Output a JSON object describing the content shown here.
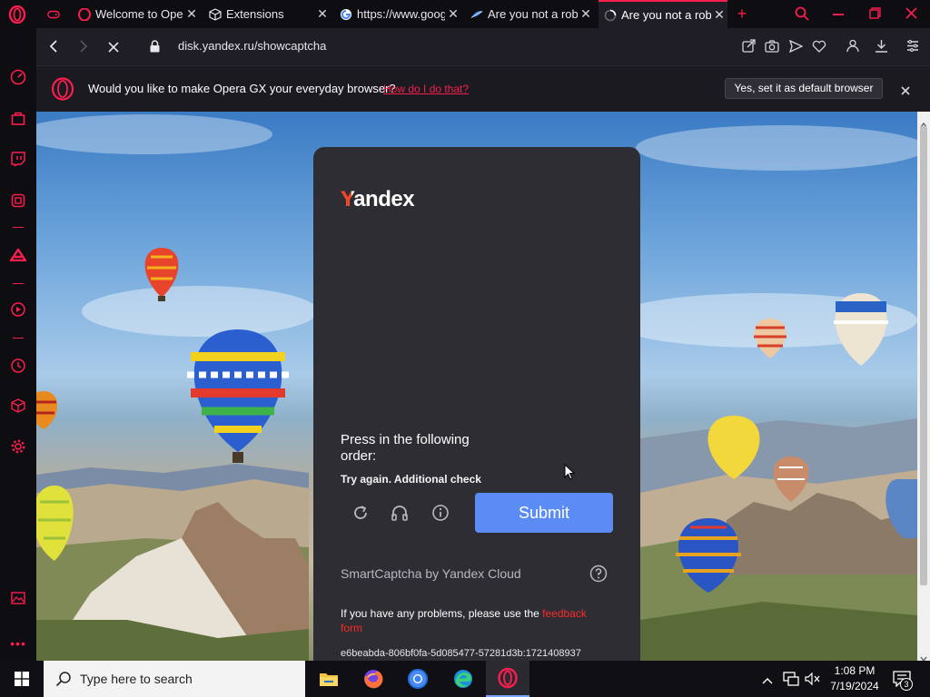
{
  "tabs": [
    {
      "title": "",
      "icon": "gamepad-icon"
    },
    {
      "title": "Welcome to Opera",
      "icon": "opera-icon"
    },
    {
      "title": "Extensions",
      "icon": "cube-icon"
    },
    {
      "title": "https://www.google",
      "icon": "google-icon"
    },
    {
      "title": "Are you not a robot",
      "icon": "feather-icon"
    },
    {
      "title": "Are you not a robot",
      "icon": "loading-icon",
      "active": true
    }
  ],
  "address": {
    "url": "disk.yandex.ru/showcaptcha"
  },
  "infobar": {
    "message": "Would you like to make Opera GX your everyday browser?",
    "link": "How do I do that?",
    "button": "Yes, set it as default browser"
  },
  "captcha": {
    "logo": "Yandex",
    "instruction": "Press in the following order:",
    "error": "Try again. Additional check",
    "submit": "Submit",
    "brand": "SmartCaptcha by Yandex Cloud",
    "help_text": "If you have any problems, please use the",
    "help_link": "feedback form",
    "request_id": "e6beabda-806bf0fa-5d085477-57281d3b:1721408937"
  },
  "taskbar": {
    "search_placeholder": "Type here to search",
    "time": "1:08 PM",
    "date": "7/19/2024",
    "notification_count": "3"
  },
  "colors": {
    "accent": "#fa1e4e",
    "submit": "#5b8cf5",
    "card": "#2e2d33"
  }
}
